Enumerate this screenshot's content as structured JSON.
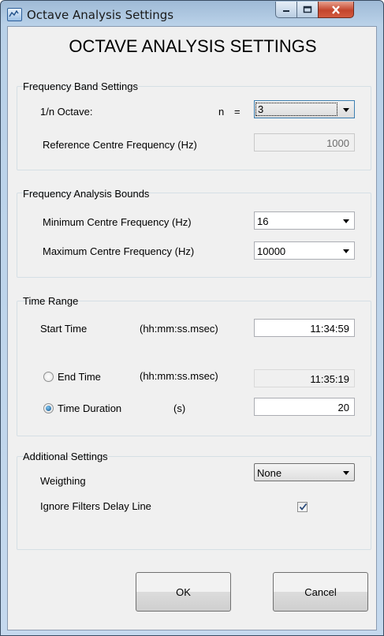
{
  "window": {
    "title": "Octave Analysis Settings",
    "controls": [
      "minimize-icon",
      "maximize-icon",
      "close-icon"
    ]
  },
  "heading": "OCTAVE ANALYSIS SETTINGS",
  "frequency_band": {
    "title": "Frequency Band Settings",
    "octave_label": "1/n Octave:",
    "n_label": "n",
    "equals": "=",
    "n_value": "3",
    "ref_label": "Reference Centre Frequency (Hz)",
    "ref_value": "1000"
  },
  "bounds": {
    "title": "Frequency Analysis Bounds",
    "min_label": "Minimum Centre Frequency (Hz)",
    "min_value": "16",
    "max_label": "Maximum Centre Frequency (Hz)",
    "max_value": "10000"
  },
  "time_range": {
    "title": "Time Range",
    "start_label": "Start Time",
    "start_format": "(hh:mm:ss.msec)",
    "start_value": "11:34:59",
    "end_label": "End Time",
    "end_format": "(hh:mm:ss.msec)",
    "end_value": "11:35:19",
    "end_selected": false,
    "duration_label": "Time Duration",
    "duration_unit": "(s)",
    "duration_value": "20",
    "duration_selected": true
  },
  "additional": {
    "title": "Additional Settings",
    "weighting_label": "Weigthing",
    "weighting_value": "None",
    "ignore_label": "Ignore Filters Delay Line",
    "ignore_checked": true
  },
  "buttons": {
    "ok": "OK",
    "cancel": "Cancel"
  }
}
